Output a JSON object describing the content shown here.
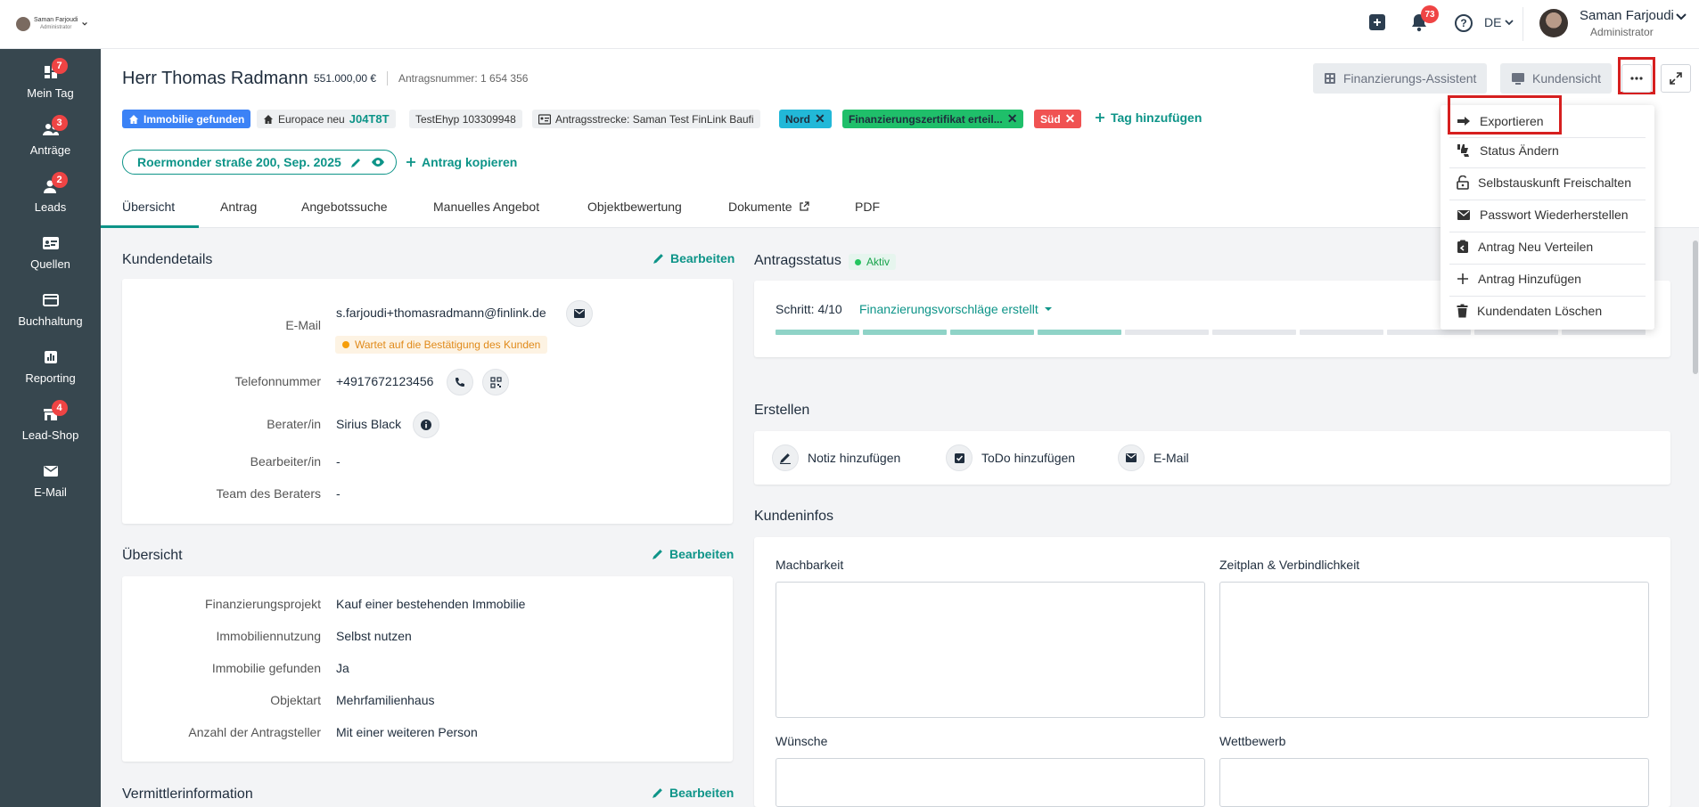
{
  "topbar": {
    "brand_user_name": "Saman Farjoudi",
    "brand_user_role": "Administrator",
    "notifications_count": "73",
    "language": "DE",
    "user_name": "Saman Farjoudi",
    "user_role": "Administrator"
  },
  "sidebar": {
    "items": [
      {
        "label": "Mein Tag",
        "badge": "7",
        "icon": "dashboard-icon"
      },
      {
        "label": "Anträge",
        "badge": "3",
        "icon": "people-icon"
      },
      {
        "label": "Leads",
        "badge": "2",
        "icon": "person-icon"
      },
      {
        "label": "Quellen",
        "badge": "",
        "icon": "id-card-icon"
      },
      {
        "label": "Buchhaltung",
        "badge": "",
        "icon": "credit-card-icon"
      },
      {
        "label": "Reporting",
        "badge": "",
        "icon": "chart-icon"
      },
      {
        "label": "Lead-Shop",
        "badge": "4",
        "icon": "shop-icon"
      },
      {
        "label": "E-Mail",
        "badge": "",
        "icon": "mail-icon"
      }
    ]
  },
  "header": {
    "title": "Herr Thomas Radmann",
    "amount": "551.000,00 €",
    "antragsnummer": "Antragsnummer: 1 654 356",
    "address_pill": "Roermonder straße 200, Sep. 2025",
    "copy_link": "Antrag kopieren",
    "finanzierungs_assistent": "Finanzierungs-Assistent",
    "kundensicht": "Kundensicht"
  },
  "tags": {
    "immobilie": "Immobilie gefunden",
    "europace_prefix": "Europace neu",
    "europace_code": "J04T8T",
    "testehyp": "TestEhyp 103309948",
    "antragsstrecke": "Antragsstrecke: Saman Test FinLink Baufi",
    "nord": "Nord",
    "zertifikat": "Finanzierungszertifikat erteil...",
    "sued": "Süd",
    "add_tag": "Tag hinzufügen"
  },
  "tabs": [
    "Übersicht",
    "Antrag",
    "Angebotssuche",
    "Manuelles Angebot",
    "Objektbewertung",
    "Dokumente",
    "PDF"
  ],
  "kundendetails": {
    "title": "Kundendetails",
    "edit": "Bearbeiten",
    "email_label": "E-Mail",
    "email_value": "s.farjoudi+thomasradmann@finlink.de",
    "warning": "Wartet auf die Bestätigung des Kunden",
    "phone_label": "Telefonnummer",
    "phone_value": "+4917672123456",
    "berater_label": "Berater/in",
    "berater_value": "Sirius Black",
    "bearbeiter_label": "Bearbeiter/in",
    "bearbeiter_value": "-",
    "team_label": "Team des Beraters",
    "team_value": "-"
  },
  "uebersicht": {
    "title": "Übersicht",
    "edit": "Bearbeiten",
    "rows": [
      {
        "label": "Finanzierungsprojekt",
        "value": "Kauf einer bestehenden Immobilie"
      },
      {
        "label": "Immobiliennutzung",
        "value": "Selbst nutzen"
      },
      {
        "label": "Immobilie gefunden",
        "value": "Ja"
      },
      {
        "label": "Objektart",
        "value": "Mehrfamilienhaus"
      },
      {
        "label": "Anzahl der Antragsteller",
        "value": "Mit einer weiteren Person"
      }
    ]
  },
  "vermittler": {
    "title": "Vermittlerinformation",
    "edit": "Bearbeiten"
  },
  "antragsstatus": {
    "title": "Antragsstatus",
    "status": "Aktiv",
    "step": "Schritt: 4/10",
    "step_name": "Finanzierungsvorschläge erstellt",
    "progress_current": 4,
    "progress_total": 10
  },
  "erstellen": {
    "title": "Erstellen",
    "notiz": "Notiz hinzufügen",
    "todo": "ToDo hinzufügen",
    "email": "E-Mail"
  },
  "kundeninfos": {
    "title": "Kundeninfos",
    "machbarkeit": "Machbarkeit",
    "zeitplan": "Zeitplan & Verbindlichkeit",
    "wuensche": "Wünsche",
    "wettbewerb": "Wettbewerb"
  },
  "dropdown": {
    "items": [
      {
        "label": "Exportieren",
        "icon": "arrow-right-icon"
      },
      {
        "label": "Status Ändern",
        "icon": "thumbs-icon"
      },
      {
        "label": "Selbstauskunft Freischalten",
        "icon": "unlock-icon"
      },
      {
        "label": "Passwort Wiederherstellen",
        "icon": "envelope-icon"
      },
      {
        "label": "Antrag Neu Verteilen",
        "icon": "clipboard-icon"
      },
      {
        "label": "Antrag Hinzufügen",
        "icon": "plus-icon"
      },
      {
        "label": "Kundendaten Löschen",
        "icon": "trash-icon"
      }
    ]
  },
  "colors": {
    "accent": "#0d9488",
    "sidebar": "#37474f",
    "badge": "#ef4444",
    "highlight": "#d61f1f"
  }
}
